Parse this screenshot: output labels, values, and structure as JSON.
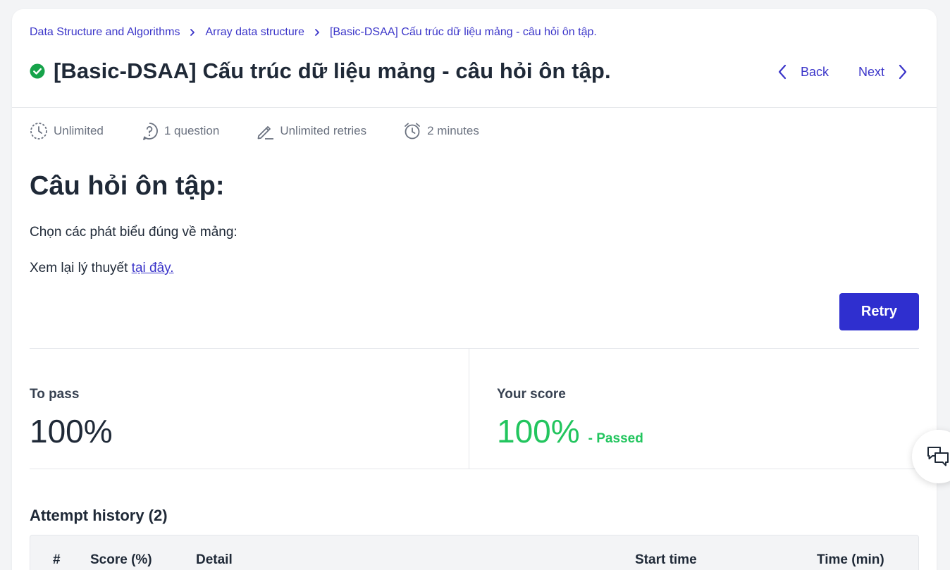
{
  "breadcrumb": {
    "items": [
      {
        "label": "Data Structure and Algorithms"
      },
      {
        "label": "Array data structure"
      },
      {
        "label": "[Basic-DSAA] Cấu trúc dữ liệu mảng - câu hỏi ôn tập."
      }
    ]
  },
  "page": {
    "title": "[Basic-DSAA] Cấu trúc dữ liệu mảng - câu hỏi ôn tập.",
    "status_icon": "check-circle-icon",
    "status_color": "#16a34a"
  },
  "nav": {
    "back_label": "Back",
    "next_label": "Next"
  },
  "meta": {
    "time_limit": "Unlimited",
    "questions": "1 question",
    "retries": "Unlimited retries",
    "duration": "2 minutes"
  },
  "content": {
    "heading": "Câu hỏi ôn tập:",
    "instruction": "Chọn các phát biểu đúng về mảng:",
    "review_prefix": "Xem lại lý thuyết ",
    "review_link": "tại đây."
  },
  "actions": {
    "retry_label": "Retry"
  },
  "stats": {
    "to_pass_label": "To pass",
    "to_pass_value": "100%",
    "your_score_label": "Your score",
    "your_score_value": "100%",
    "your_score_status": "- Passed"
  },
  "history": {
    "title": "Attempt history (2)",
    "columns": [
      "#",
      "Score (%)",
      "Detail",
      "Start time",
      "Time (min)"
    ]
  },
  "colors": {
    "accent": "#3b35c9",
    "button": "#2f2fcf",
    "passed": "#22c55e",
    "text": "#1f2937"
  }
}
